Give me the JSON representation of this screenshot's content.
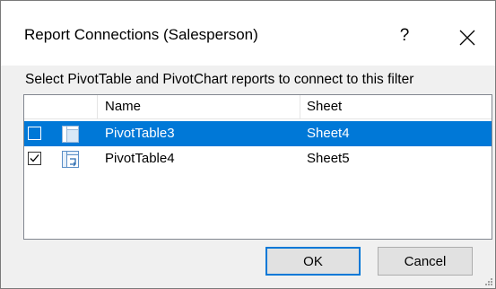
{
  "dialog": {
    "title": "Report Connections (Salesperson)",
    "help_glyph": "?",
    "close_glyph": "✕",
    "instruction": "Select PivotTable and PivotChart reports to connect to this filter"
  },
  "list": {
    "columns": [
      "Name",
      "Sheet"
    ],
    "rows": [
      {
        "name": "PivotTable3",
        "sheet": "Sheet4",
        "checked": false,
        "selected": true,
        "icon": "pivottable-icon"
      },
      {
        "name": "PivotTable4",
        "sheet": "Sheet5",
        "checked": true,
        "selected": false,
        "icon": "pivottable-icon"
      }
    ]
  },
  "buttons": {
    "ok_label": "OK",
    "cancel_label": "Cancel"
  },
  "colors": {
    "selection": "#0078d7",
    "dialog_bg": "#f0f0f0"
  }
}
